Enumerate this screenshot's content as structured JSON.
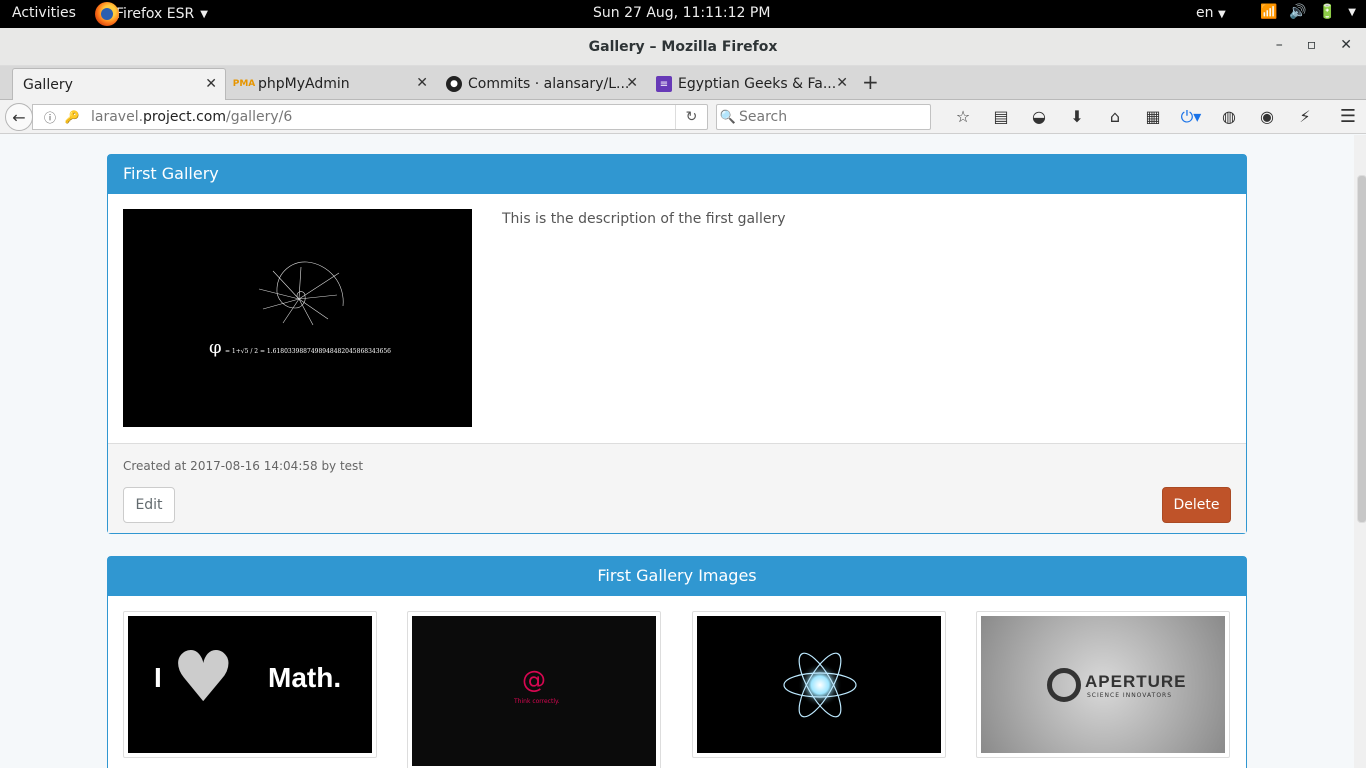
{
  "topbar": {
    "activities": "Activities",
    "app_name": "Firefox ESR",
    "clock": "Sun 27 Aug, 11:11:12 PM",
    "lang": "en"
  },
  "window": {
    "title": "Gallery – Mozilla Firefox"
  },
  "tabs": [
    {
      "label": "Gallery",
      "icon": "blank-page-icon",
      "active": true
    },
    {
      "label": "phpMyAdmin",
      "icon": "phpmyadmin-icon"
    },
    {
      "label": "Commits · alansary/L...",
      "icon": "github-icon"
    },
    {
      "label": "Egyptian Geeks & Fa...",
      "icon": "list-icon"
    }
  ],
  "navbar": {
    "url_prefix": "laravel.",
    "url_domain": "project.com",
    "url_path": "/gallery/6",
    "search_placeholder": "Search"
  },
  "gallery": {
    "title": "First Gallery",
    "description": "This is the description of the first gallery",
    "created": "Created at 2017-08-16 14:04:58 by test",
    "edit_label": "Edit",
    "delete_label": "Delete",
    "cover_formula": "φ = (1+√5)/2 = 1.6180339887498948482045868343656"
  },
  "images_panel": {
    "title": "First Gallery Images",
    "images": [
      {
        "name": "i-love-math",
        "text_left": "I",
        "text_right": "Math."
      },
      {
        "name": "debian-think-correctly",
        "text": "Think correctly."
      },
      {
        "name": "atom",
        "text": ""
      },
      {
        "name": "aperture",
        "text": "APERTURE",
        "subtext": "SCIENCE INNOVATORS"
      }
    ]
  },
  "colors": {
    "panel_blue": "#3097d1",
    "delete_red": "#bf5329"
  }
}
